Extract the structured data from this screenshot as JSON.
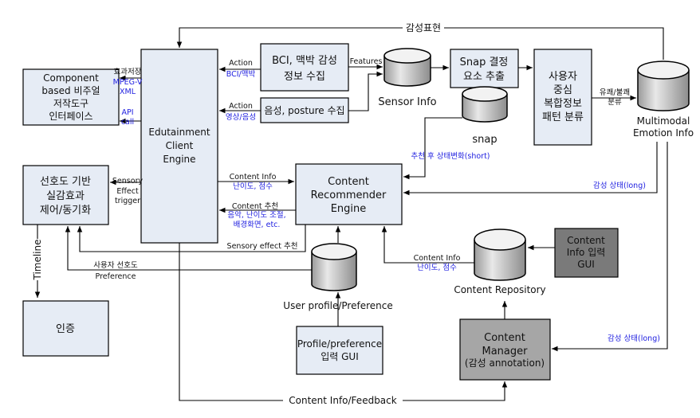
{
  "boxes": {
    "component": [
      "Component",
      "based 비주얼",
      "저작도구",
      "인터페이스"
    ],
    "edutainment": [
      "Edutainment",
      "Client",
      "Engine"
    ],
    "bci": [
      "BCI, 맥박 감성",
      "정보 수집"
    ],
    "voice": "음성, posture 수집",
    "snap_extract": [
      "Snap  결정",
      "요소 추출"
    ],
    "pattern": [
      "사용자",
      "중심",
      "복합정보",
      "패턴 분류"
    ],
    "preference_control": [
      "선호도 기반",
      "실감효과",
      "제어/동기화"
    ],
    "auth": "인증",
    "recommender": [
      "Content",
      "Recommender",
      "Engine"
    ],
    "profile_gui": [
      "Profile/preference",
      "입력 GUI"
    ],
    "content_info_gui": [
      "Content",
      "Info 입력",
      "GUI"
    ],
    "content_manager": [
      "Content",
      "Manager",
      "(감성 annotation)"
    ]
  },
  "databases": {
    "sensor": "Sensor Info",
    "snap": "snap",
    "emotion": [
      "Multimodal",
      "Emotion Info"
    ],
    "user_profile": "User profile/Preference",
    "repository": "Content Repository"
  },
  "labels": {
    "emotion_expression": "감성표현",
    "save_effect": "효과저장",
    "mpegv": [
      "MPEG-V",
      "XML"
    ],
    "api": [
      "API",
      "call"
    ],
    "action1": "Action",
    "action1_sub": "BCI/맥박",
    "action2": "Action",
    "action2_sub": "영상/음성",
    "features": "Features",
    "pleasant": "유쾌/불쾌",
    "classify": "분류",
    "after_rec": "추천 후 상태변화(short)",
    "emotion_long1": "감성 상태(long)",
    "emotion_long2": "감성 상태(long)",
    "sensory_trigger": [
      "Sensory",
      "Effect",
      "trigger"
    ],
    "content_info": "Content Info",
    "content_info_sub": "난이도, 점수",
    "content_rec": "Content 추천",
    "content_rec_sub": [
      "음악, 난이도 조절,",
      "배경화면, etc."
    ],
    "sensory_rec": "Sensory effect 추천",
    "user_pref": "사용자 선호도",
    "preference": "Preference",
    "timeline": "Timeline",
    "repo_info": "Content Info",
    "repo_info_sub": "난이도, 점수",
    "feedback": "Content Info/Feedback"
  }
}
